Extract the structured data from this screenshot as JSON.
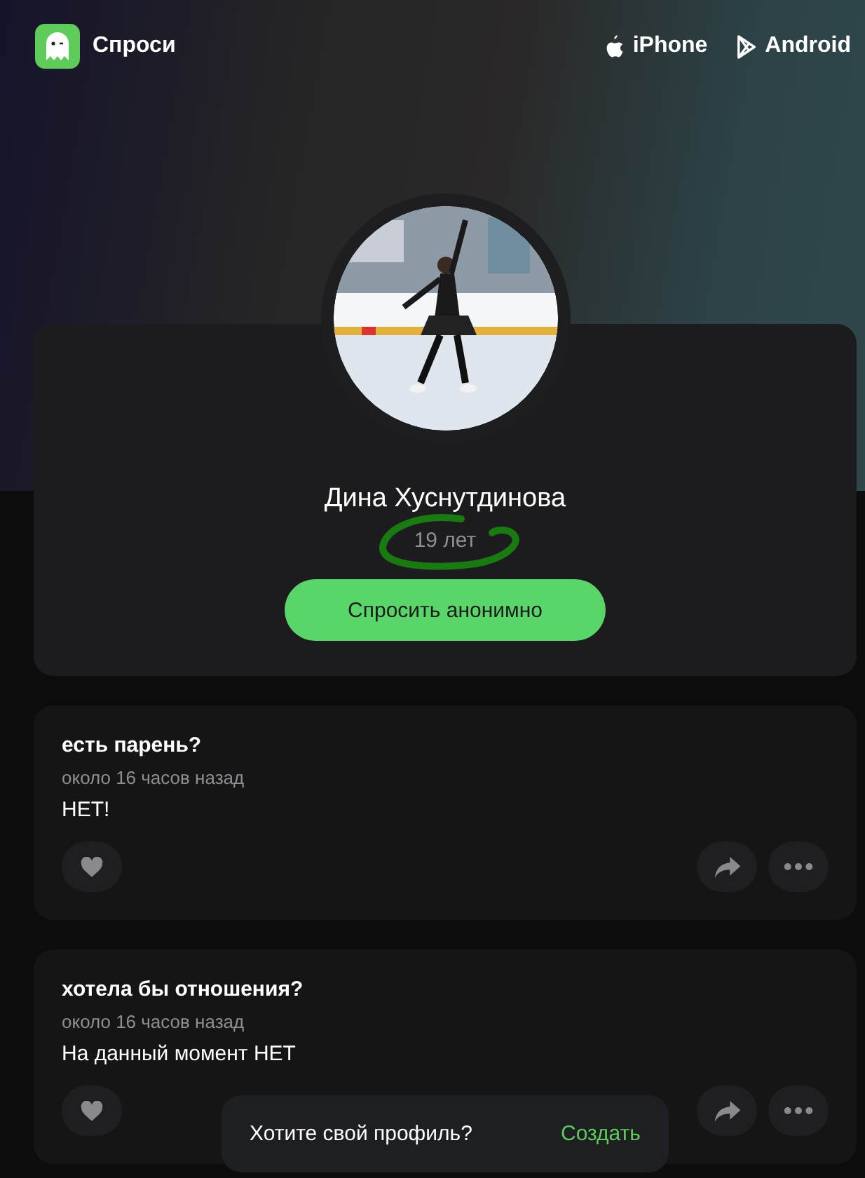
{
  "header": {
    "brand": "Спроси",
    "links": [
      {
        "kind": "apple",
        "label": "iPhone"
      },
      {
        "kind": "play",
        "label": "Android"
      }
    ]
  },
  "profile": {
    "name": "Дина Хуснутдинова",
    "age": "19 лет",
    "ask_button": "Спросить анонимно"
  },
  "questions": [
    {
      "question": "есть парень?",
      "time": "около 16 часов назад",
      "answer": "НЕТ!",
      "liked": false
    },
    {
      "question": "хотела бы отношения?",
      "time": "около 16 часов назад",
      "answer": "На данный момент НЕТ",
      "liked": false
    }
  ],
  "toast": {
    "text": "Хотите свой профиль?",
    "action": "Создать"
  }
}
